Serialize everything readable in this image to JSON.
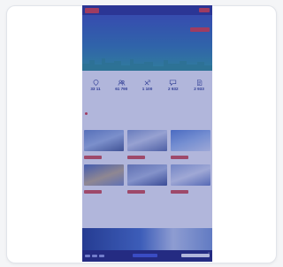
{
  "topbar": {
    "links": [
      "",
      "",
      ""
    ],
    "cta_label": ""
  },
  "hero": {
    "title": "",
    "subtitle": ""
  },
  "stats": {
    "title": "",
    "items": [
      {
        "value": "33 11",
        "label": "",
        "icon": "map-pin-icon"
      },
      {
        "value": "61 790",
        "label": "",
        "icon": "users-icon"
      },
      {
        "value": "1 100",
        "label": "",
        "icon": "tools-icon"
      },
      {
        "value": "2 932",
        "label": "",
        "icon": "speech-bubble-icon"
      },
      {
        "value": "2 933",
        "label": "",
        "icon": "document-icon"
      }
    ]
  },
  "section": {
    "heading": "",
    "subheading": ""
  },
  "tiles": [
    {
      "title": "",
      "text": ""
    },
    {
      "title": "",
      "text": ""
    },
    {
      "title": "",
      "text": ""
    },
    {
      "title": "",
      "text": ""
    },
    {
      "title": "",
      "text": ""
    },
    {
      "title": "",
      "text": ""
    }
  ],
  "cookie": {
    "text": ""
  },
  "colors": {
    "brand_navy": "#27318f",
    "accent_red": "#e23b3b",
    "overlay": "#323ea0"
  }
}
